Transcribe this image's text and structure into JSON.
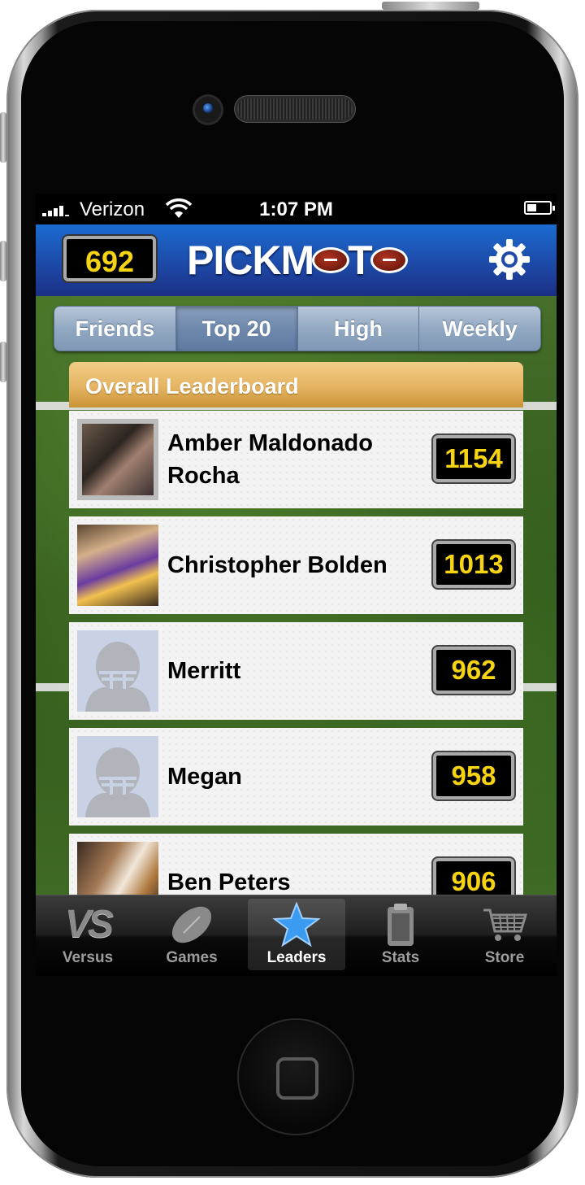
{
  "status_bar": {
    "carrier": "Verizon",
    "time": "1:07 PM"
  },
  "header": {
    "coins": "692",
    "logo_text": "PICKMOTO"
  },
  "segments": [
    {
      "label": "Friends"
    },
    {
      "label": "Top 20"
    },
    {
      "label": "High"
    },
    {
      "label": "Weekly"
    }
  ],
  "leaderboard": {
    "title": "Overall Leaderboard",
    "rows": [
      {
        "name": "Amber Maldonado Rocha",
        "score": "1154"
      },
      {
        "name": "Christopher Bolden",
        "score": "1013"
      },
      {
        "name": "Merritt",
        "score": "962"
      },
      {
        "name": "Megan",
        "score": "958"
      },
      {
        "name": "Ben Peters",
        "score": "906"
      }
    ]
  },
  "tabs": [
    {
      "label": "Versus",
      "icon": "vs-icon"
    },
    {
      "label": "Games",
      "icon": "football-icon"
    },
    {
      "label": "Leaders",
      "icon": "star-icon"
    },
    {
      "label": "Stats",
      "icon": "clipboard-icon"
    },
    {
      "label": "Store",
      "icon": "cart-icon"
    }
  ],
  "colors": {
    "header_blue": "#1d4aa8",
    "score_yellow": "#f6d313",
    "leaderboard_header": "#e5b463",
    "active_tab_star": "#3a9bf0"
  }
}
